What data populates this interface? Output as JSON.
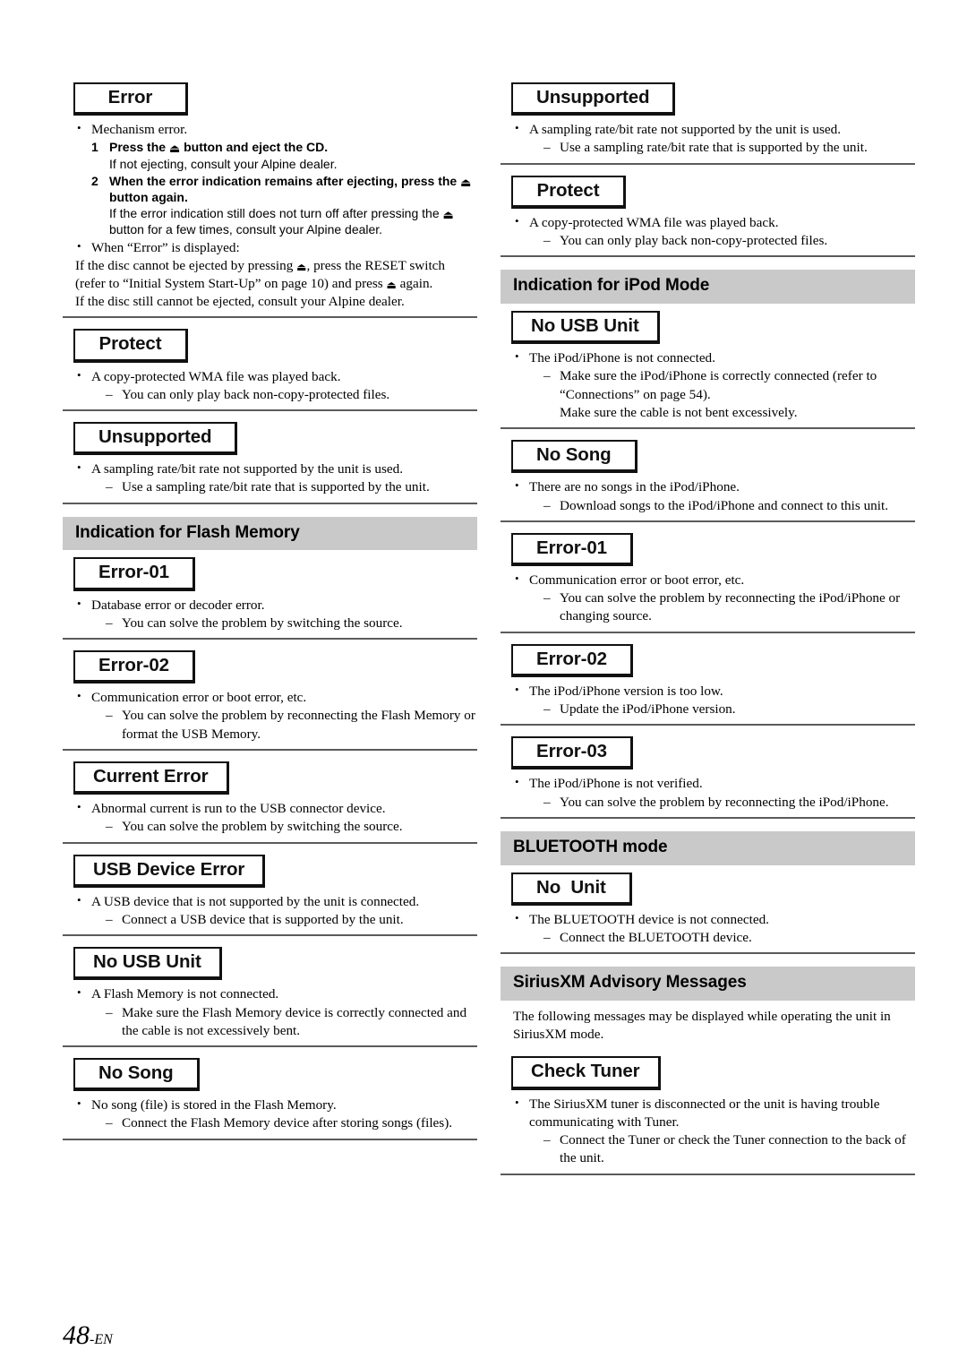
{
  "page": {
    "number": "48",
    "suffix": "-EN"
  },
  "symbols": {
    "eject": "⏏"
  },
  "left_column": {
    "sections": [
      {
        "chip": "Error",
        "bullets": [
          {
            "text": "Mechanism error."
          }
        ],
        "steps": [
          {
            "num": "1",
            "head_pre": "Press the ",
            "head_post": " button and eject the CD.",
            "body": "If not ejecting, consult your Alpine dealer."
          },
          {
            "num": "2",
            "head_pre": "When the error indication remains after ejecting, press the ",
            "head_post": " button again.",
            "body_pre": "If the error indication still does not turn off after pressing the ",
            "body_post": " button for a few times, consult your Alpine dealer."
          }
        ],
        "trailing_bullet": {
          "text": "When “Error” is displayed:",
          "lines_pre": "If the disc cannot be ejected by pressing ",
          "lines_mid": ", press the RESET switch (refer to “Initial System Start-Up” on page 10) and press ",
          "lines_post": " again.",
          "last_line": "If the disc still cannot be ejected, consult your Alpine dealer."
        }
      },
      {
        "chip": "Protect",
        "bullets": [
          {
            "text": "A copy-protected WMA file was played back.",
            "sub": [
              "You can only play back non-copy-protected files."
            ]
          }
        ]
      },
      {
        "chip": "Unsupported",
        "bullets": [
          {
            "text": "A sampling rate/bit rate not supported by the unit is used.",
            "sub": [
              "Use a sampling rate/bit rate that is supported by the unit."
            ]
          }
        ]
      }
    ],
    "band_flash": "Indication for Flash Memory",
    "flash_sections": [
      {
        "chip": "Error-01",
        "bullets": [
          {
            "text": "Database error or decoder error.",
            "sub": [
              "You can solve the problem by switching the source."
            ]
          }
        ]
      },
      {
        "chip": "Error-02",
        "bullets": [
          {
            "text": "Communication error or boot error, etc.",
            "sub": [
              "You can solve the problem by reconnecting the Flash Memory or format the USB Memory."
            ]
          }
        ]
      },
      {
        "chip": "Current Error",
        "bullets": [
          {
            "text": "Abnormal current is run to the USB connector device.",
            "sub": [
              "You can solve the problem by switching the source."
            ]
          }
        ]
      },
      {
        "chip": "USB Device Error",
        "bullets": [
          {
            "text": "A USB device that is not supported by the unit is connected.",
            "sub": [
              "Connect a USB device that is supported by the unit."
            ]
          }
        ]
      },
      {
        "chip": "No USB Unit",
        "bullets": [
          {
            "text": "A Flash Memory is not connected.",
            "sub": [
              "Make sure the Flash Memory device is correctly connected and the cable is not excessively bent."
            ]
          }
        ]
      },
      {
        "chip": "No Song",
        "bullets": [
          {
            "text": "No song (file) is stored in the Flash Memory.",
            "sub": [
              "Connect the Flash Memory device after storing songs (files)."
            ]
          }
        ]
      }
    ]
  },
  "right_column": {
    "top_sections": [
      {
        "chip": "Unsupported",
        "bullets": [
          {
            "text": "A sampling rate/bit rate not supported by the unit is used.",
            "sub": [
              "Use a sampling rate/bit rate that is supported by the unit."
            ]
          }
        ]
      },
      {
        "chip": "Protect",
        "bullets": [
          {
            "text": "A copy-protected WMA file was played back.",
            "sub": [
              "You can only play back non-copy-protected files."
            ]
          }
        ]
      }
    ],
    "band_ipod": "Indication for iPod Mode",
    "ipod_sections": [
      {
        "chip": "No USB Unit",
        "bullets": [
          {
            "text": "The iPod/iPhone is not connected.",
            "sub": [
              "Make sure the iPod/iPhone is correctly connected (refer to “Connections” on page 54)."
            ],
            "sub_extra": [
              "Make sure the cable is not bent excessively."
            ]
          }
        ]
      },
      {
        "chip": "No Song",
        "bullets": [
          {
            "text": "There are no songs in the iPod/iPhone.",
            "sub": [
              "Download songs to the iPod/iPhone and connect to this unit."
            ]
          }
        ]
      },
      {
        "chip": "Error-01",
        "bullets": [
          {
            "text": "Communication error or boot error, etc.",
            "sub": [
              "You can solve the problem by reconnecting the iPod/iPhone or changing source."
            ]
          }
        ]
      },
      {
        "chip": "Error-02",
        "bullets": [
          {
            "text": "The iPod/iPhone version is too low.",
            "sub": [
              "Update the iPod/iPhone version."
            ]
          }
        ]
      },
      {
        "chip": "Error-03",
        "bullets": [
          {
            "text": "The iPod/iPhone is not verified.",
            "sub": [
              "You can solve the problem by reconnecting the iPod/iPhone."
            ]
          }
        ]
      }
    ],
    "band_bluetooth": "BLUETOOTH mode",
    "bluetooth_sections": [
      {
        "chip": "No  Unit",
        "bullets": [
          {
            "text": "The BLUETOOTH device is not connected.",
            "sub": [
              "Connect the BLUETOOTH device."
            ]
          }
        ]
      }
    ],
    "band_siriusxm": "SiriusXM Advisory Messages",
    "siriusxm_intro": "The following messages may be displayed while operating the unit in SiriusXM mode.",
    "siriusxm_sections": [
      {
        "chip": "Check Tuner",
        "bullets": [
          {
            "text": "The SiriusXM tuner is disconnected or the unit is having trouble communicating with Tuner.",
            "sub": [
              "Connect the Tuner or check the Tuner connection to the back of the unit."
            ]
          }
        ]
      }
    ]
  }
}
